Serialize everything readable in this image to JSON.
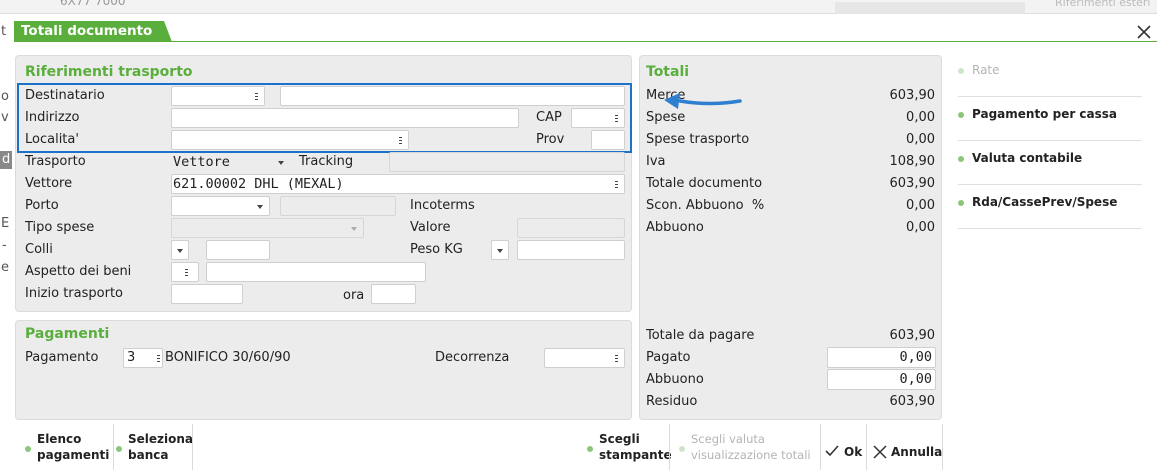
{
  "window": {
    "title": "Totali documento",
    "bg_fragment": "6X77 7000",
    "bg_right_fragment": "Riferimenti esteri",
    "left_edge_letters": [
      "t",
      "o",
      "v",
      "d",
      "E",
      "-",
      "e"
    ]
  },
  "trasporto": {
    "section_title": "Riferimenti trasporto",
    "destinatario_label": "Destinatario",
    "indirizzo_label": "Indirizzo",
    "cap_label": "CAP",
    "localita_label": "Localita'",
    "prov_label": "Prov",
    "trasporto_label": "Trasporto",
    "trasporto_value": "Vettore",
    "tracking_label": "Tracking",
    "vettore_label": "Vettore",
    "vettore_value": "621.00002 DHL (MEXAL)",
    "porto_label": "Porto",
    "incoterms_label": "Incoterms",
    "tipo_spese_label": "Tipo spese",
    "valore_label": "Valore",
    "colli_label": "Colli",
    "peso_label": "Peso KG",
    "aspetto_label": "Aspetto dei beni",
    "inizio_label": "Inizio trasporto",
    "ora_label": "ora"
  },
  "pagamenti": {
    "section_title": "Pagamenti",
    "pagamento_label": "Pagamento",
    "pagamento_code": "3",
    "pagamento_desc": "BONIFICO 30/60/90",
    "decorrenza_label": "Decorrenza"
  },
  "totali": {
    "section_title": "Totali",
    "rows": [
      {
        "label": "Merce",
        "value": "603,90"
      },
      {
        "label": "Spese",
        "value": "0,00"
      },
      {
        "label": "Spese trasporto",
        "value": "0,00"
      },
      {
        "label": "Iva",
        "value": "108,90"
      },
      {
        "label": "Totale documento",
        "value": "603,90"
      },
      {
        "label": "Scon. Abbuono  %",
        "value": "0,00"
      },
      {
        "label": "Abbuono",
        "value": "0,00"
      }
    ],
    "totale_da_pagare_label": "Totale da pagare",
    "totale_da_pagare_value": "603,90",
    "pagato_label": "Pagato",
    "pagato_value": "0,00",
    "abbuono_label": "Abbuono",
    "abbuono_value": "0,00",
    "residuo_label": "Residuo",
    "residuo_value": "603,90"
  },
  "sidebar": {
    "items": [
      {
        "label": "Rate",
        "enabled": false
      },
      {
        "label": "Pagamento per cassa",
        "enabled": true
      },
      {
        "label": "Valuta contabile",
        "enabled": true
      },
      {
        "label": "Rda/CassePrev/Spese",
        "enabled": true
      }
    ]
  },
  "footer": {
    "elenco_line1": "Elenco",
    "elenco_line2": "pagamenti",
    "seleziona_line1": "Seleziona",
    "seleziona_line2": "banca",
    "stampante_line1": "Scegli",
    "stampante_line2": "stampante",
    "valuta_line1": "Scegli valuta",
    "valuta_line2": "visualizzazione totali",
    "ok_label": "Ok",
    "annulla_label": "Annulla"
  },
  "colors": {
    "accent_green": "#5aae3c",
    "highlight_blue": "#1a73c9",
    "arrow_blue": "#2f7fd0"
  }
}
